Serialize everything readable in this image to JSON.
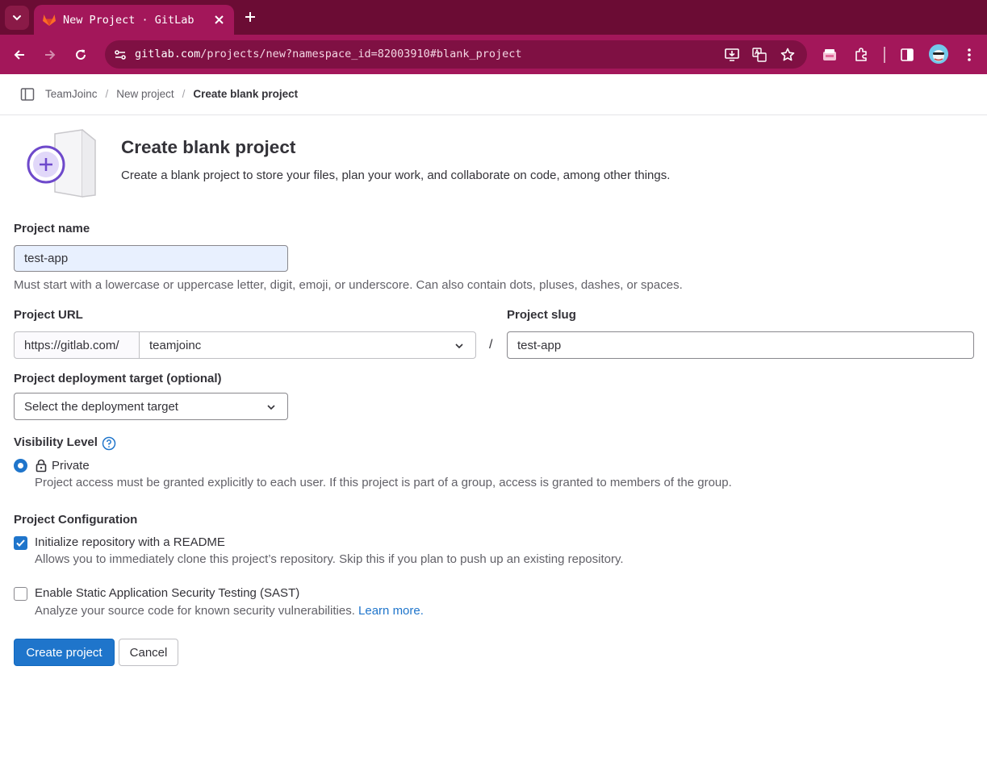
{
  "browser": {
    "tab_title": "New Project · GitLab",
    "url_host": "gitlab.com",
    "url_path": "/projects/new?namespace_id=82003910#blank_project",
    "accent_color": "#a3175a"
  },
  "breadcrumb": {
    "items": [
      "TeamJoinc",
      "New project"
    ],
    "current": "Create blank project"
  },
  "header": {
    "title": "Create blank project",
    "description": "Create a blank project to store your files, plan your work, and collaborate on code, among other things."
  },
  "form": {
    "project_name": {
      "label": "Project name",
      "value": "test-app",
      "help": "Must start with a lowercase or uppercase letter, digit, emoji, or underscore. Can also contain dots, pluses, dashes, or spaces."
    },
    "project_url": {
      "label": "Project URL",
      "prefix": "https://gitlab.com/",
      "namespace": "teamjoinc",
      "separator": "/"
    },
    "project_slug": {
      "label": "Project slug",
      "value": "test-app"
    },
    "deployment_target": {
      "label": "Project deployment target (optional)",
      "selected": "Select the deployment target"
    },
    "visibility": {
      "label": "Visibility Level",
      "option_label": "Private",
      "option_help": "Project access must be granted explicitly to each user. If this project is part of a group, access is granted to members of the group."
    },
    "configuration": {
      "label": "Project Configuration",
      "readme": {
        "label": "Initialize repository with a README",
        "help": "Allows you to immediately clone this project’s repository. Skip this if you plan to push up an existing repository.",
        "checked": true
      },
      "sast": {
        "label": "Enable Static Application Security Testing (SAST)",
        "help": "Analyze your source code for known security vulnerabilities.",
        "link": "Learn more.",
        "checked": false
      }
    },
    "actions": {
      "create": "Create project",
      "cancel": "Cancel"
    }
  },
  "colors": {
    "primary": "#1f75cb",
    "text": "#333238",
    "muted": "#626168"
  }
}
